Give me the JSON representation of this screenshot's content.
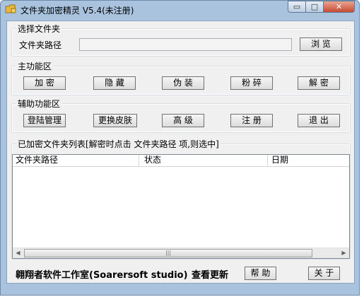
{
  "window": {
    "title": "文件夹加密精灵 V5.4(未注册)",
    "controls": {
      "minimize": "▭",
      "maximize": "□",
      "close": "✕"
    }
  },
  "folder_select": {
    "group_label": "选择文件夹",
    "path_label": "文件夹路径",
    "path_value": "",
    "browse_button": "浏 览"
  },
  "main_functions": {
    "group_label": "主功能区",
    "buttons": [
      "加  密",
      "隐 藏",
      "伪 装",
      "粉 碎",
      "解  密"
    ]
  },
  "aux_functions": {
    "group_label": "辅助功能区",
    "buttons": [
      "登陆管理",
      "更换皮肤",
      "高 级",
      "注 册",
      "退 出"
    ]
  },
  "encrypted_list": {
    "group_label": "已加密文件夹列表[解密时点击 文件夹路径 项,则选中]",
    "columns": [
      "文件夹路径",
      "状态",
      "日期"
    ],
    "rows": [],
    "scrollbar": {
      "left": "◀",
      "right": "▶",
      "grip": "|||"
    }
  },
  "footer": {
    "studio": "翱翔者软件工作室(Soarersoft studio)",
    "check_update": "查看更新",
    "help_button": "帮 助",
    "about_button": "关 于"
  },
  "colors": {
    "window_frame": "#a9c3de",
    "client_bg": "#f0f0f0",
    "close_button": "#c74a32"
  }
}
